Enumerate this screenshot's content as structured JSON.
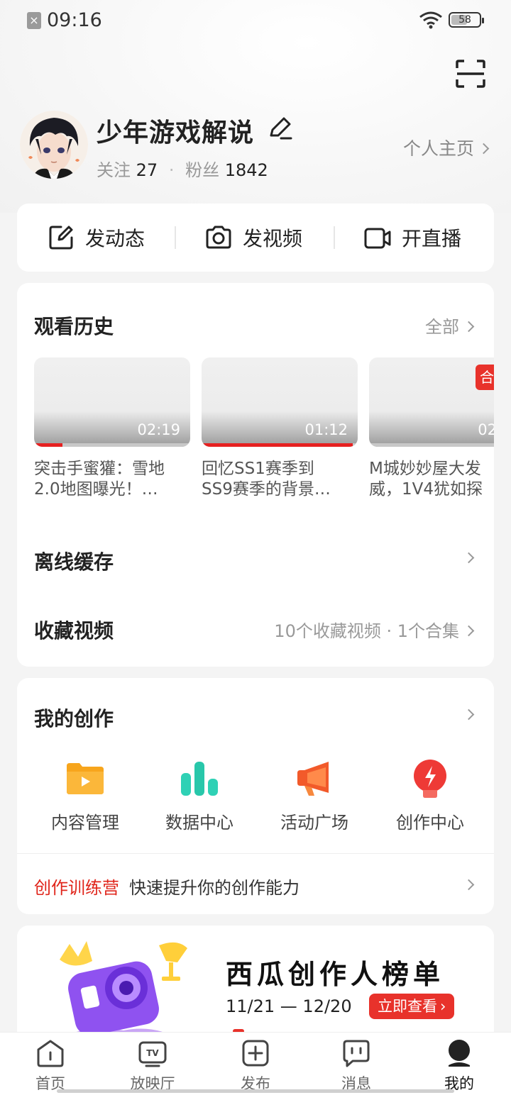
{
  "status_bar": {
    "time": "09:16",
    "battery": "58",
    "battery_fraction": 0.58
  },
  "profile": {
    "username": "少年游戏解说",
    "following_label": "关注",
    "following_count": "27",
    "followers_label": "粉丝",
    "followers_count": "1842",
    "homepage_link": "个人主页"
  },
  "post_actions": [
    {
      "label": "发动态",
      "icon": "edit-square-icon"
    },
    {
      "label": "发视频",
      "icon": "camera-icon"
    },
    {
      "label": "开直播",
      "icon": "video-camera-icon"
    }
  ],
  "history": {
    "title": "观看历史",
    "all_label": "全部",
    "videos": [
      {
        "duration": "02:19",
        "progress": 0.18,
        "title_line1": "突击手蜜獾：雪地",
        "title_line2": "2.0地图曝光！…"
      },
      {
        "duration": "01:12",
        "progress": 0.97,
        "title_line1": "回忆SS1赛季到",
        "title_line2": "SS9赛季的背景…"
      },
      {
        "duration": "02",
        "progress": 0.0,
        "badge": "合",
        "title_line1": "M城妙妙屋大发",
        "title_line2": "威，1V4犹如探"
      }
    ]
  },
  "offline_cache": {
    "label": "离线缓存"
  },
  "favorites": {
    "label": "收藏视频",
    "summary": "10个收藏视频 · 1个合集"
  },
  "creation": {
    "title": "我的创作",
    "tools": [
      {
        "label": "内容管理",
        "icon": "folder-play-icon",
        "color": "#f7a51c"
      },
      {
        "label": "数据中心",
        "icon": "bar-chart-icon",
        "color": "#2fd1b5"
      },
      {
        "label": "活动广场",
        "icon": "megaphone-icon",
        "color": "#f25a2a"
      },
      {
        "label": "创作中心",
        "icon": "lightning-bulb-icon",
        "color": "#ee3a36"
      }
    ],
    "camp_label": "创作训练营",
    "camp_text": "快速提升你的创作能力"
  },
  "banner": {
    "title": "西瓜创作人榜单",
    "date_range": "11/21 — 12/20",
    "button": "立即查看"
  },
  "tabbar": [
    {
      "label": "首页",
      "icon": "home-icon",
      "active": false
    },
    {
      "label": "放映厅",
      "icon": "tv-icon",
      "active": false
    },
    {
      "label": "发布",
      "icon": "add-icon",
      "active": false
    },
    {
      "label": "消息",
      "icon": "message-icon",
      "active": false
    },
    {
      "label": "我的",
      "icon": "profile-icon",
      "active": true
    }
  ],
  "colors": {
    "accent_red": "#e8322b",
    "text_dark": "#222222",
    "text_gray": "#999999"
  }
}
